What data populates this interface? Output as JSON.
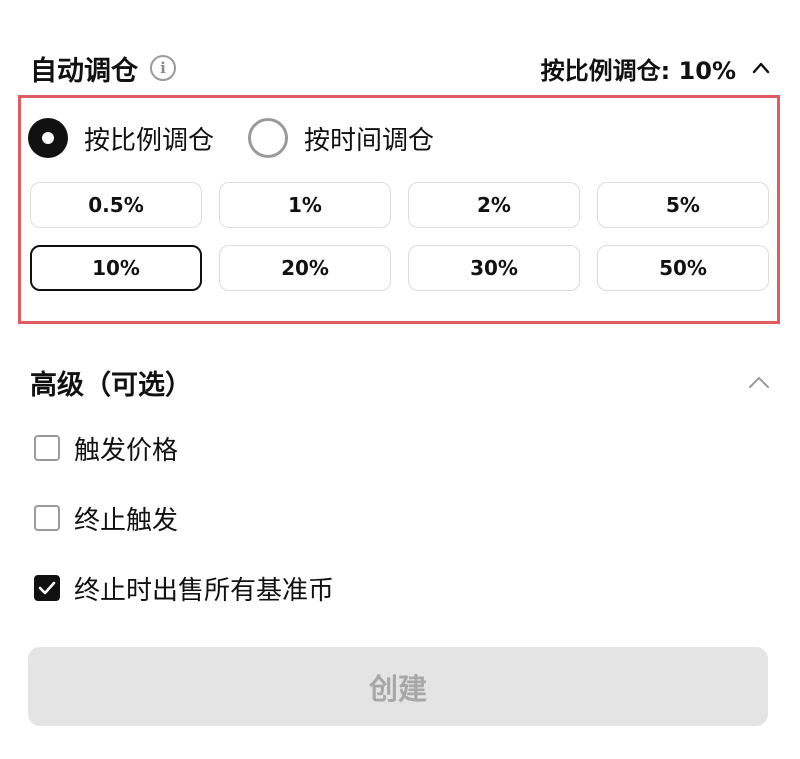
{
  "auto_rebalance": {
    "title": "自动调仓",
    "summary": "按比例调仓: 10%",
    "modes": [
      {
        "label": "按比例调仓",
        "selected": true
      },
      {
        "label": "按时间调仓",
        "selected": false
      }
    ],
    "percent_options": [
      "0.5%",
      "1%",
      "2%",
      "5%",
      "10%",
      "20%",
      "30%",
      "50%"
    ],
    "selected_percent": "10%"
  },
  "advanced": {
    "title": "高级（可选）",
    "options": [
      {
        "label": "触发价格",
        "checked": false
      },
      {
        "label": "终止触发",
        "checked": false
      },
      {
        "label": "终止时出售所有基准币",
        "checked": true
      }
    ]
  },
  "create_button": {
    "label": "创建",
    "disabled": true
  },
  "icons": {
    "info": "info-icon",
    "collapse": "chevron-up-icon",
    "check": "checkmark-icon"
  },
  "colors": {
    "highlight_border": "#e25b60",
    "primary": "#111111",
    "disabled_bg": "#e4e4e4",
    "disabled_text": "#a8a8a8"
  }
}
